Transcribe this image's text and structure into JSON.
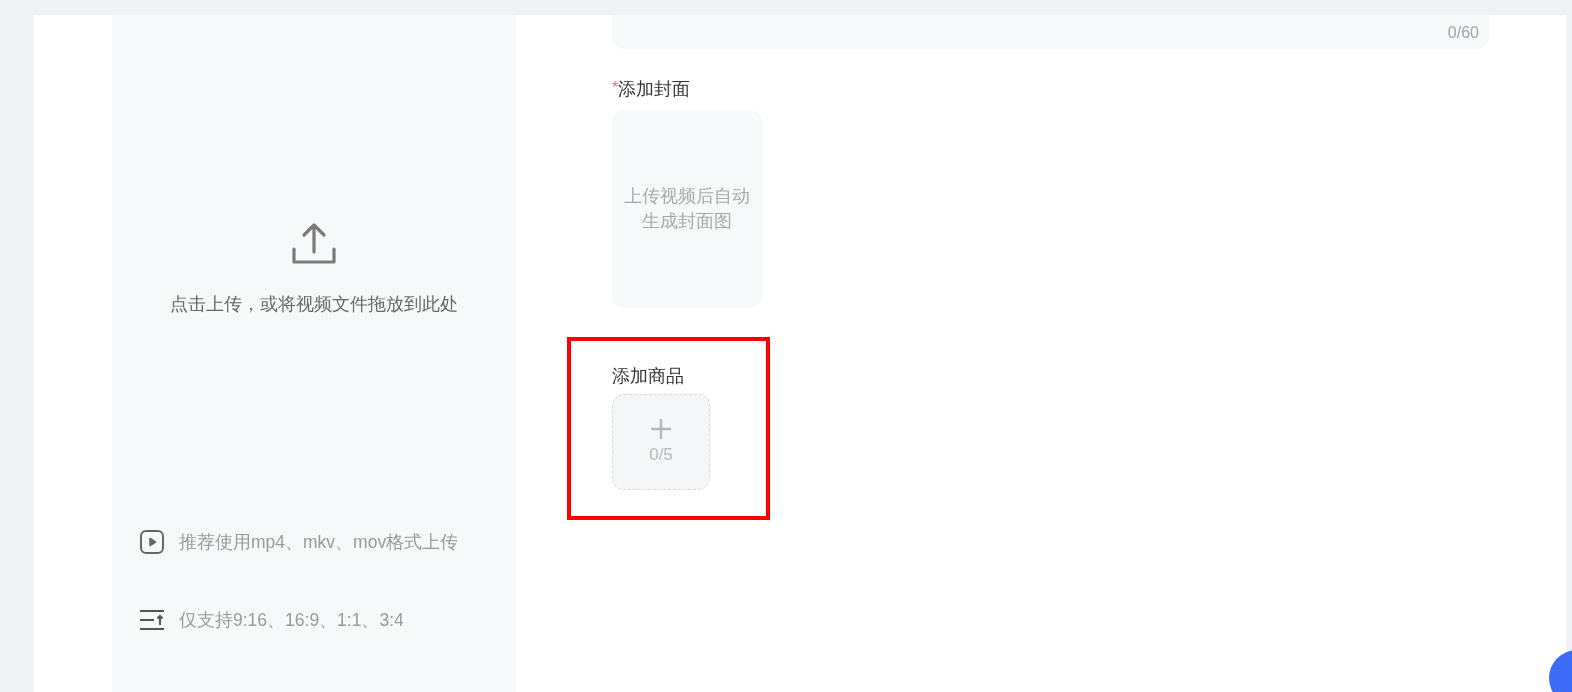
{
  "title_field": {
    "counter": "0/60"
  },
  "upload": {
    "prompt": "点击上传，或将视频文件拖放到此处",
    "hints": [
      {
        "kind": "format",
        "text": "推荐使用mp4、mkv、mov格式上传"
      },
      {
        "kind": "ratio",
        "text": "仅支持9:16、16:9、1:1、3:4"
      }
    ]
  },
  "cover": {
    "required_mark": "*",
    "label": "添加封面",
    "hint": "上传视频后自动生成封面图"
  },
  "product": {
    "label": "添加商品",
    "counter": "0/5"
  }
}
